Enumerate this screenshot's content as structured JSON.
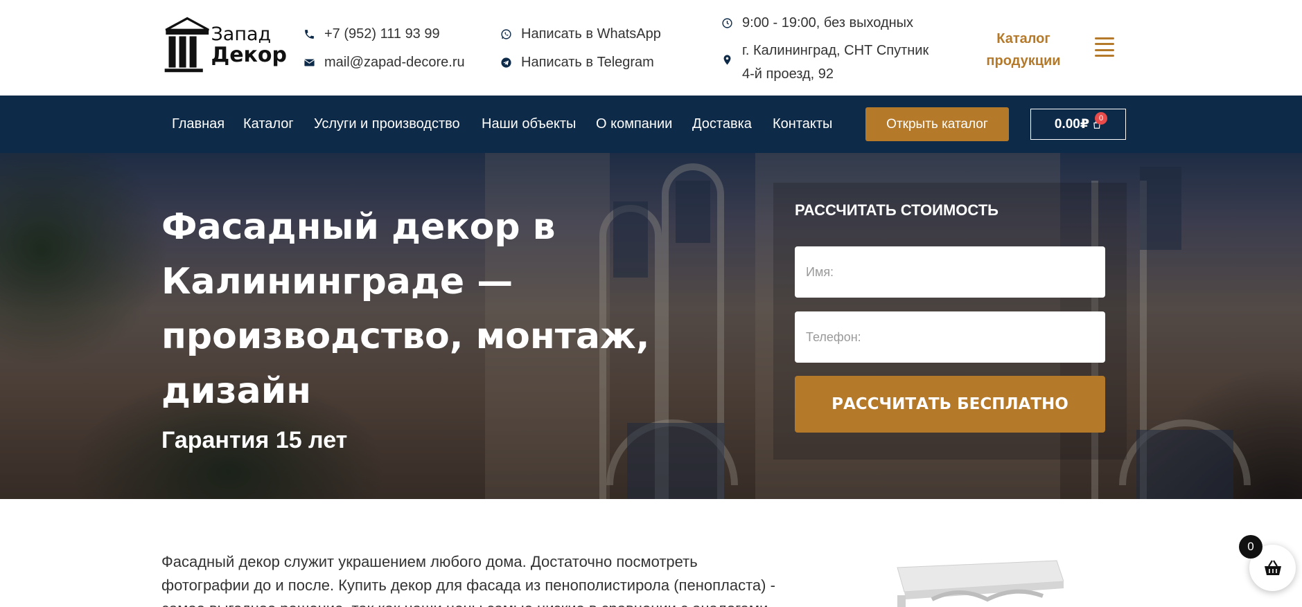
{
  "brand": {
    "line1": "Запад",
    "line2": "Декор"
  },
  "contacts": {
    "phone": "+7 (952) 111 93 99",
    "email": "mail@zapad-decore.ru",
    "whatsapp": "Написать в WhatsApp",
    "telegram": "Написать в Telegram",
    "hours": "9:00 - 19:00, без выходных",
    "address_line1": "г. Калининград, СНТ Спутник",
    "address_line2": "4-й проезд, 92"
  },
  "header": {
    "catalog_line1": "Каталог",
    "catalog_line2": "продукции"
  },
  "nav": {
    "items": [
      "Главная",
      "Каталог",
      "Услуги и производство",
      "Наши объекты",
      "О компании",
      "Доставка",
      "Контакты"
    ],
    "open_catalog": "Открыть каталог",
    "cart_total": "0.00₽",
    "cart_count": "0"
  },
  "hero": {
    "title": "Фасадный декор в Калининграде — производство, монтаж, дизайн",
    "subtitle": "Гарантия 15 лет"
  },
  "calc_form": {
    "title": "РАССЧИТАТЬ СТОИМОСТЬ",
    "name_placeholder": "Имя:",
    "phone_placeholder": "Телефон:",
    "submit": "РАССЧИТАТЬ БЕСПЛАТНО"
  },
  "intro": {
    "text": "Фасадный декор служит украшением любого дома. Достаточно посмотреть фотографии до и после. Купить декор для фасада из пенополистирола (пенопласта) - самое выгодное решение, так как наши цены самые низкие в сравнении с аналогами"
  },
  "floating_cart": {
    "count": "0"
  },
  "colors": {
    "accent": "#b5792a",
    "nav_bg": "#0d2a48",
    "badge": "#e94b4b"
  }
}
